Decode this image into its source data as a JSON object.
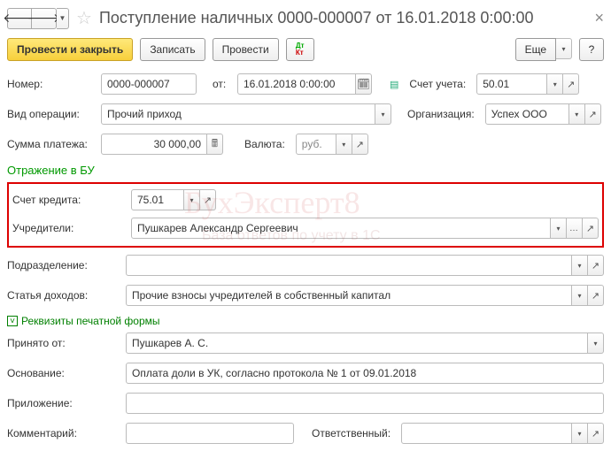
{
  "header": {
    "title": "Поступление наличных 0000-000007 от 16.01.2018 0:00:00"
  },
  "toolbar": {
    "post_close": "Провести и закрыть",
    "write": "Записать",
    "post": "Провести",
    "more": "Еще",
    "help": "?"
  },
  "labels": {
    "number": "Номер:",
    "from": "от:",
    "account": "Счет учета:",
    "op_type": "Вид операции:",
    "org": "Организация:",
    "amount": "Сумма платежа:",
    "currency": "Валюта:",
    "section_bu": "Отражение в БУ",
    "credit_acc": "Счет кредита:",
    "founders": "Учредители:",
    "department": "Подразделение:",
    "income_item": "Статья доходов:",
    "print_req": "Реквизиты печатной формы",
    "received_from": "Принято от:",
    "basis": "Основание:",
    "attachment": "Приложение:",
    "comment": "Комментарий:",
    "responsible": "Ответственный:"
  },
  "values": {
    "number": "0000-000007",
    "date": "16.01.2018  0:00:00",
    "account": "50.01",
    "op_type": "Прочий приход",
    "org": "Успех ООО",
    "amount": "30 000,00",
    "currency": "руб.",
    "credit_acc": "75.01",
    "founders": "Пушкарев Александр Сергеевич",
    "department": "",
    "income_item": "Прочие взносы учредителей в собственный капитал",
    "received_from": "Пушкарев А. С.",
    "basis": "Оплата доли в УК, согласно протокола № 1 от 09.01.2018",
    "attachment": "",
    "comment": "",
    "responsible": ""
  },
  "watermark": {
    "line1": "БухЭксперт8",
    "line2": "База ответов по учету в 1С"
  }
}
